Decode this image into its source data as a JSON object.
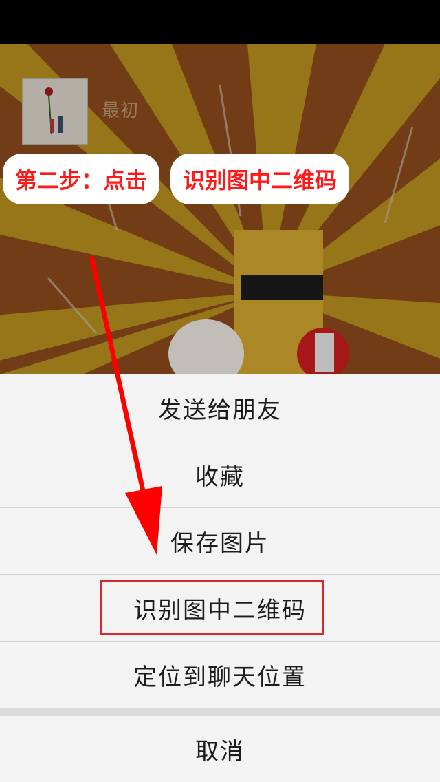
{
  "chat": {
    "contact_name": "最初"
  },
  "annotation": {
    "step_text": "第二步：点击",
    "target_text": "识别图中二维码"
  },
  "action_sheet": {
    "items": [
      {
        "label": "发送给朋友"
      },
      {
        "label": "收藏"
      },
      {
        "label": "保存图片"
      },
      {
        "label": "识别图中二维码"
      },
      {
        "label": "定位到聊天位置"
      }
    ],
    "cancel_label": "取消"
  },
  "colors": {
    "highlight": "#d9262f",
    "annotation": "#ff1a1a"
  }
}
